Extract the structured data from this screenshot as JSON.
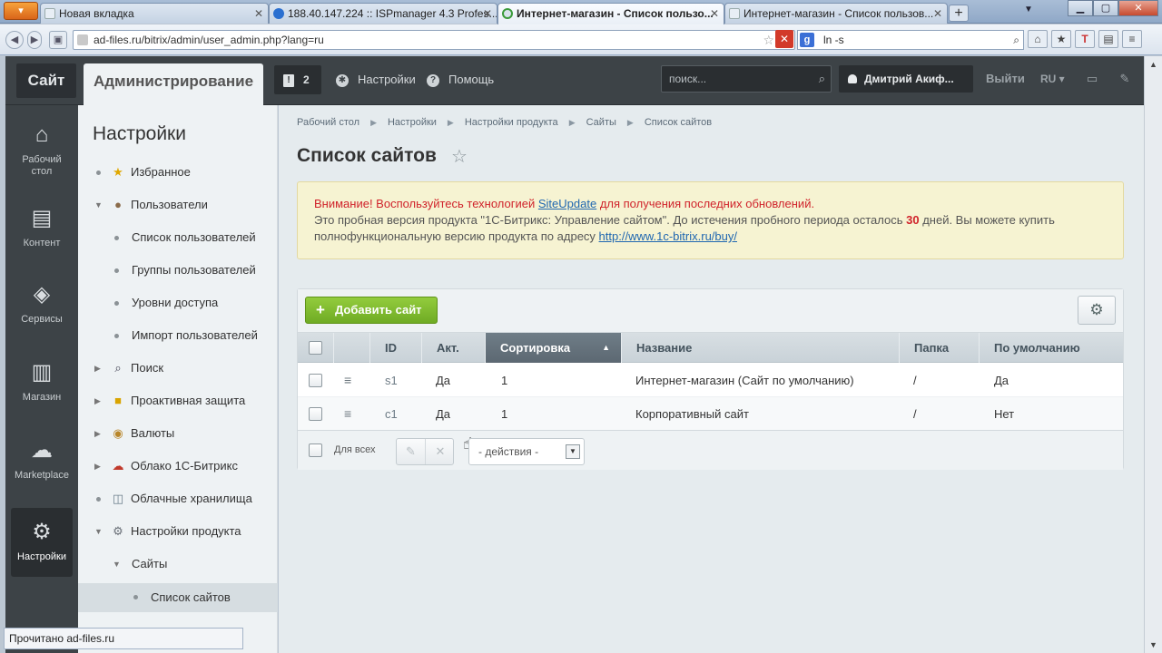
{
  "browser": {
    "tabs": [
      {
        "label": "Новая вкладка"
      },
      {
        "label": "188.40.147.224 :: ISPmanager 4.3 Profes..."
      },
      {
        "label": "Интернет-магазин - Список пользо..."
      },
      {
        "label": "Интернет-магазин - Список пользов..."
      }
    ],
    "url": "ad-files.ru/bitrix/admin/user_admin.php?lang=ru",
    "search_value": "ln -s",
    "status_text": "Прочитано ad-files.ru"
  },
  "admin": {
    "site_label": "Сайт",
    "admin_label": "Администрирование",
    "notifications_count": "2",
    "settings_label": "Настройки",
    "help_label": "Помощь",
    "search_placeholder": "поиск...",
    "user_name": "Дмитрий Акиф...",
    "logout_label": "Выйти",
    "lang_label": "RU"
  },
  "rail": [
    {
      "label": "Рабочий стол",
      "icon": "home-icon"
    },
    {
      "label": "Контент",
      "icon": "document-icon"
    },
    {
      "label": "Сервисы",
      "icon": "layers-icon"
    },
    {
      "label": "Магазин",
      "icon": "basket-icon"
    },
    {
      "label": "Marketplace",
      "icon": "cloud-download-icon"
    },
    {
      "label": "Настройки",
      "icon": "gear-icon"
    }
  ],
  "menu": {
    "title": "Настройки",
    "items": [
      {
        "label": "Избранное"
      },
      {
        "label": "Пользователи"
      },
      {
        "label": "Список пользователей"
      },
      {
        "label": "Группы пользователей"
      },
      {
        "label": "Уровни доступа"
      },
      {
        "label": "Импорт пользователей"
      },
      {
        "label": "Поиск"
      },
      {
        "label": "Проактивная защита"
      },
      {
        "label": "Валюты"
      },
      {
        "label": "Облако 1С-Битрикс"
      },
      {
        "label": "Облачные хранилища"
      },
      {
        "label": "Настройки продукта"
      },
      {
        "label": "Сайты"
      },
      {
        "label": "Список сайтов"
      }
    ]
  },
  "breadcrumbs": [
    "Рабочий стол",
    "Настройки",
    "Настройки продукта",
    "Сайты",
    "Список сайтов"
  ],
  "page_title": "Список сайтов",
  "alert": {
    "l1_pre": "Внимание! Воспользуйтесь технологией ",
    "l1_link": "SiteUpdate",
    "l1_post": " для получения последних обновлений.",
    "l2_pre": "Это пробная версия продукта \"1С-Битрикс: Управление сайтом\". До истечения пробного периода осталось ",
    "l2_days": "30",
    "l2_post": " дней. Вы можете купить",
    "l3_pre": "полнофункциональную версию продукта по адресу ",
    "l3_link": "http://www.1c-bitrix.ru/buy/"
  },
  "grid": {
    "add_label": "Добавить сайт",
    "columns": [
      "ID",
      "Акт.",
      "Сортировка",
      "Название",
      "Папка",
      "По умолчанию"
    ],
    "rows": [
      {
        "id": "s1",
        "active": "Да",
        "sort": "1",
        "name": "Интернет-магазин (Сайт по умолчанию)",
        "folder": "/",
        "default": "Да"
      },
      {
        "id": "c1",
        "active": "Да",
        "sort": "1",
        "name": "Корпоративный сайт",
        "folder": "/",
        "default": "Нет"
      }
    ],
    "for_all_label": "Для всех",
    "actions_label": "- действия -"
  }
}
